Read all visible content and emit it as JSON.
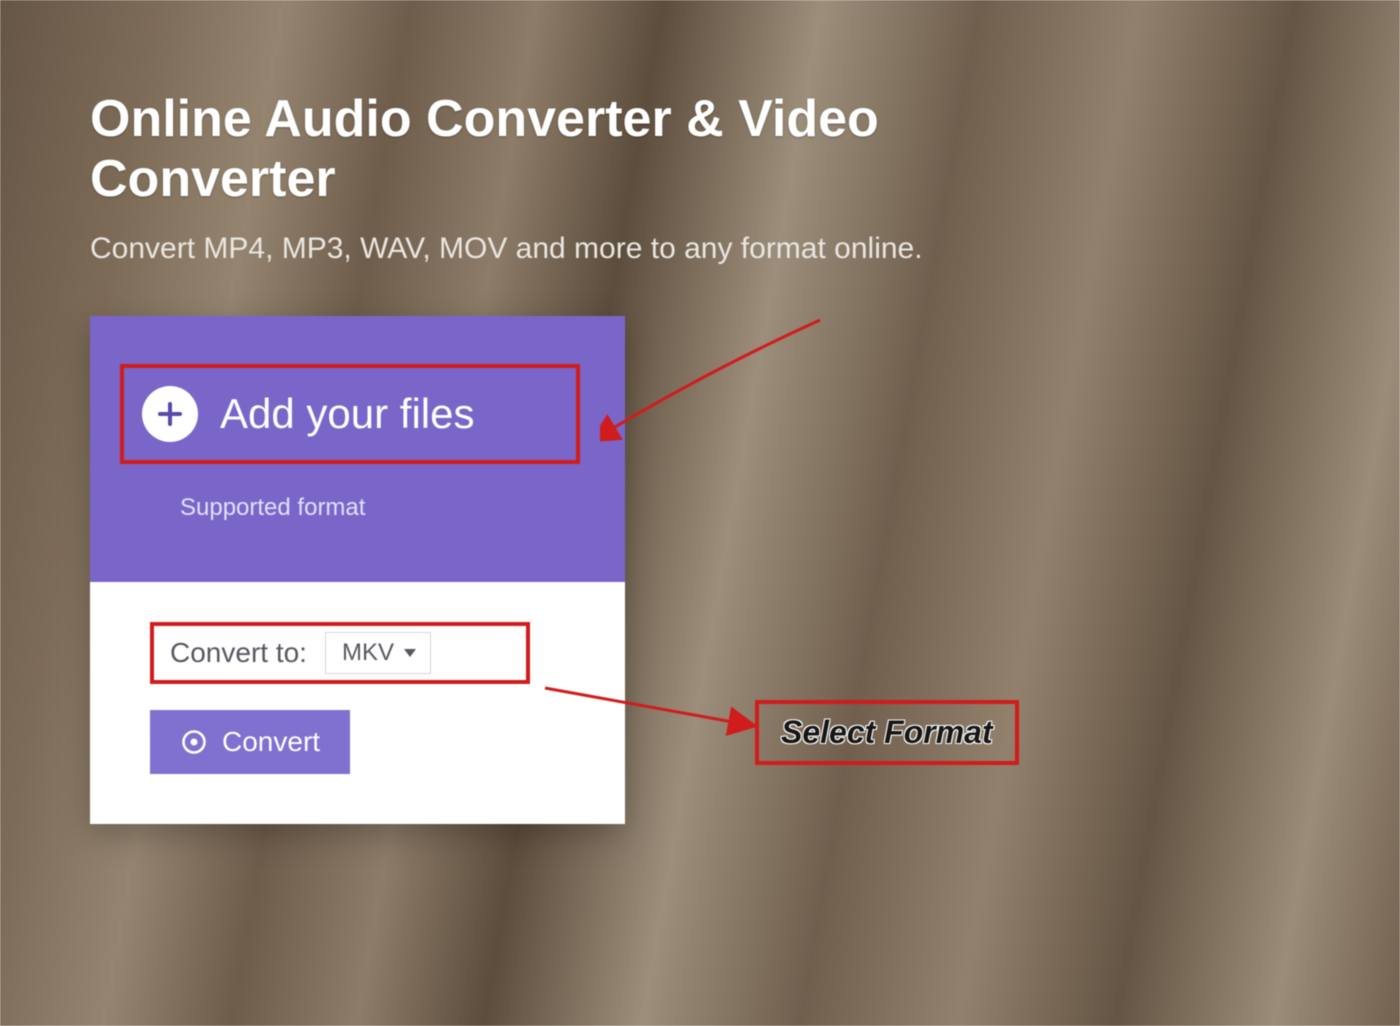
{
  "header": {
    "title": "Online Audio Converter & Video Converter",
    "subtitle": "Convert MP4, MP3, WAV, MOV and more to any format online."
  },
  "panel": {
    "add_files_label": "Add your files",
    "supported_format_label": "Supported format",
    "convert_to_label": "Convert to:",
    "selected_format": "MKV",
    "convert_button_label": "Convert"
  },
  "annotations": {
    "select_format_callout": "Select Format"
  },
  "colors": {
    "accent_purple": "#7a66c8",
    "button_purple": "#8070d0",
    "highlight_red": "#d01c1c"
  }
}
